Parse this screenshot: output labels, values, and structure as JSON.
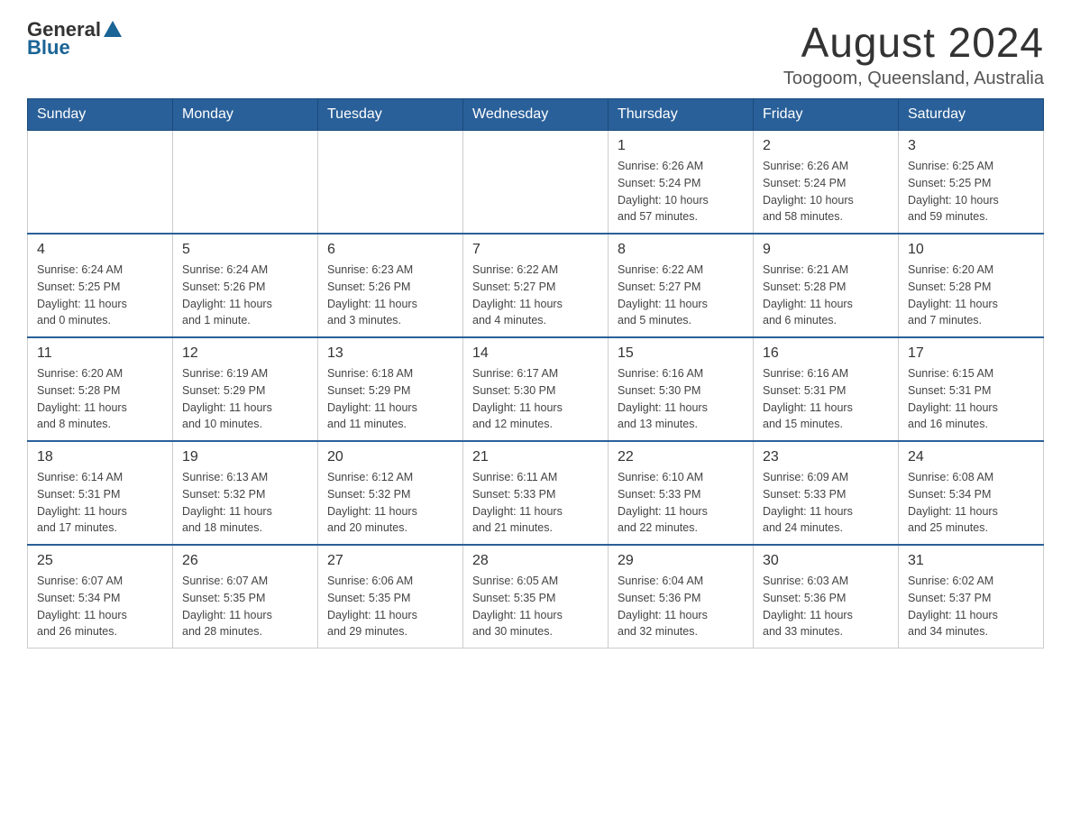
{
  "header": {
    "logo": {
      "text_general": "General",
      "text_blue": "Blue"
    },
    "title": "August 2024",
    "location": "Toogoom, Queensland, Australia"
  },
  "days_of_week": [
    "Sunday",
    "Monday",
    "Tuesday",
    "Wednesday",
    "Thursday",
    "Friday",
    "Saturday"
  ],
  "weeks": [
    {
      "cells": [
        {
          "day": "",
          "info": ""
        },
        {
          "day": "",
          "info": ""
        },
        {
          "day": "",
          "info": ""
        },
        {
          "day": "",
          "info": ""
        },
        {
          "day": "1",
          "info": "Sunrise: 6:26 AM\nSunset: 5:24 PM\nDaylight: 10 hours\nand 57 minutes."
        },
        {
          "day": "2",
          "info": "Sunrise: 6:26 AM\nSunset: 5:24 PM\nDaylight: 10 hours\nand 58 minutes."
        },
        {
          "day": "3",
          "info": "Sunrise: 6:25 AM\nSunset: 5:25 PM\nDaylight: 10 hours\nand 59 minutes."
        }
      ]
    },
    {
      "cells": [
        {
          "day": "4",
          "info": "Sunrise: 6:24 AM\nSunset: 5:25 PM\nDaylight: 11 hours\nand 0 minutes."
        },
        {
          "day": "5",
          "info": "Sunrise: 6:24 AM\nSunset: 5:26 PM\nDaylight: 11 hours\nand 1 minute."
        },
        {
          "day": "6",
          "info": "Sunrise: 6:23 AM\nSunset: 5:26 PM\nDaylight: 11 hours\nand 3 minutes."
        },
        {
          "day": "7",
          "info": "Sunrise: 6:22 AM\nSunset: 5:27 PM\nDaylight: 11 hours\nand 4 minutes."
        },
        {
          "day": "8",
          "info": "Sunrise: 6:22 AM\nSunset: 5:27 PM\nDaylight: 11 hours\nand 5 minutes."
        },
        {
          "day": "9",
          "info": "Sunrise: 6:21 AM\nSunset: 5:28 PM\nDaylight: 11 hours\nand 6 minutes."
        },
        {
          "day": "10",
          "info": "Sunrise: 6:20 AM\nSunset: 5:28 PM\nDaylight: 11 hours\nand 7 minutes."
        }
      ]
    },
    {
      "cells": [
        {
          "day": "11",
          "info": "Sunrise: 6:20 AM\nSunset: 5:28 PM\nDaylight: 11 hours\nand 8 minutes."
        },
        {
          "day": "12",
          "info": "Sunrise: 6:19 AM\nSunset: 5:29 PM\nDaylight: 11 hours\nand 10 minutes."
        },
        {
          "day": "13",
          "info": "Sunrise: 6:18 AM\nSunset: 5:29 PM\nDaylight: 11 hours\nand 11 minutes."
        },
        {
          "day": "14",
          "info": "Sunrise: 6:17 AM\nSunset: 5:30 PM\nDaylight: 11 hours\nand 12 minutes."
        },
        {
          "day": "15",
          "info": "Sunrise: 6:16 AM\nSunset: 5:30 PM\nDaylight: 11 hours\nand 13 minutes."
        },
        {
          "day": "16",
          "info": "Sunrise: 6:16 AM\nSunset: 5:31 PM\nDaylight: 11 hours\nand 15 minutes."
        },
        {
          "day": "17",
          "info": "Sunrise: 6:15 AM\nSunset: 5:31 PM\nDaylight: 11 hours\nand 16 minutes."
        }
      ]
    },
    {
      "cells": [
        {
          "day": "18",
          "info": "Sunrise: 6:14 AM\nSunset: 5:31 PM\nDaylight: 11 hours\nand 17 minutes."
        },
        {
          "day": "19",
          "info": "Sunrise: 6:13 AM\nSunset: 5:32 PM\nDaylight: 11 hours\nand 18 minutes."
        },
        {
          "day": "20",
          "info": "Sunrise: 6:12 AM\nSunset: 5:32 PM\nDaylight: 11 hours\nand 20 minutes."
        },
        {
          "day": "21",
          "info": "Sunrise: 6:11 AM\nSunset: 5:33 PM\nDaylight: 11 hours\nand 21 minutes."
        },
        {
          "day": "22",
          "info": "Sunrise: 6:10 AM\nSunset: 5:33 PM\nDaylight: 11 hours\nand 22 minutes."
        },
        {
          "day": "23",
          "info": "Sunrise: 6:09 AM\nSunset: 5:33 PM\nDaylight: 11 hours\nand 24 minutes."
        },
        {
          "day": "24",
          "info": "Sunrise: 6:08 AM\nSunset: 5:34 PM\nDaylight: 11 hours\nand 25 minutes."
        }
      ]
    },
    {
      "cells": [
        {
          "day": "25",
          "info": "Sunrise: 6:07 AM\nSunset: 5:34 PM\nDaylight: 11 hours\nand 26 minutes."
        },
        {
          "day": "26",
          "info": "Sunrise: 6:07 AM\nSunset: 5:35 PM\nDaylight: 11 hours\nand 28 minutes."
        },
        {
          "day": "27",
          "info": "Sunrise: 6:06 AM\nSunset: 5:35 PM\nDaylight: 11 hours\nand 29 minutes."
        },
        {
          "day": "28",
          "info": "Sunrise: 6:05 AM\nSunset: 5:35 PM\nDaylight: 11 hours\nand 30 minutes."
        },
        {
          "day": "29",
          "info": "Sunrise: 6:04 AM\nSunset: 5:36 PM\nDaylight: 11 hours\nand 32 minutes."
        },
        {
          "day": "30",
          "info": "Sunrise: 6:03 AM\nSunset: 5:36 PM\nDaylight: 11 hours\nand 33 minutes."
        },
        {
          "day": "31",
          "info": "Sunrise: 6:02 AM\nSunset: 5:37 PM\nDaylight: 11 hours\nand 34 minutes."
        }
      ]
    }
  ]
}
